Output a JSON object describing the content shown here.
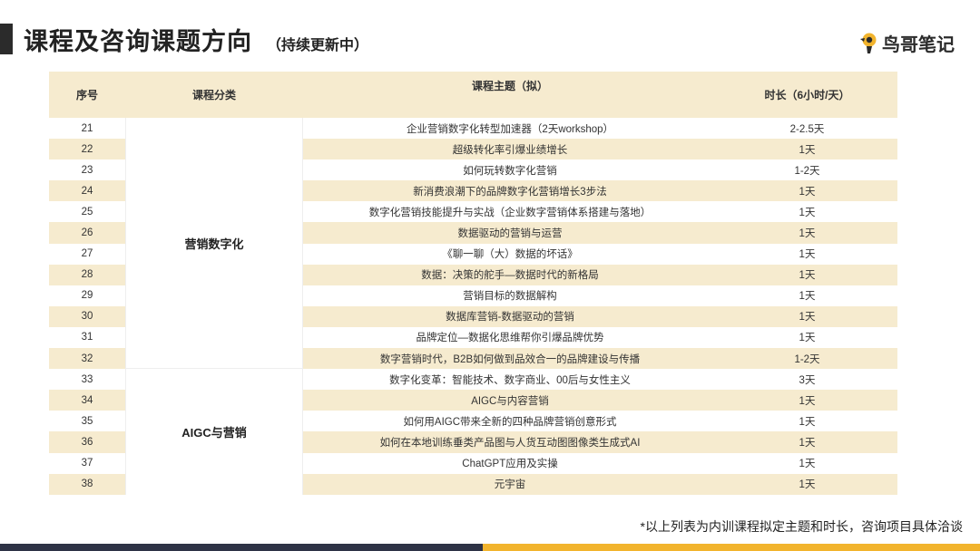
{
  "header": {
    "title": "课程及咨询课题方向",
    "subtitle": "（持续更新中）",
    "logo_text": "鸟哥笔记"
  },
  "table": {
    "columns": [
      "序号",
      "课程分类",
      "课程主题（拟）",
      "时长（6小时/天）"
    ],
    "groups": [
      {
        "name": "营销数字化",
        "rows": 12
      },
      {
        "name": "AIGC与营销",
        "rows": 6
      }
    ],
    "rows": [
      {
        "no": "21",
        "topic": "企业营销数字化转型加速器（2天workshop）",
        "duration": "2-2.5天"
      },
      {
        "no": "22",
        "topic": "超级转化率引爆业绩增长",
        "duration": "1天"
      },
      {
        "no": "23",
        "topic": "如何玩转数字化营销",
        "duration": "1-2天"
      },
      {
        "no": "24",
        "topic": "新消费浪潮下的品牌数字化营销增长3步法",
        "duration": "1天"
      },
      {
        "no": "25",
        "topic": "数字化营销技能提升与实战（企业数字营销体系搭建与落地）",
        "duration": "1天"
      },
      {
        "no": "26",
        "topic": "数据驱动的营销与运营",
        "duration": "1天"
      },
      {
        "no": "27",
        "topic": "《聊一聊（大）数据的坏话》",
        "duration": "1天"
      },
      {
        "no": "28",
        "topic": "数据：决策的舵手—数据时代的新格局",
        "duration": "1天"
      },
      {
        "no": "29",
        "topic": "营销目标的数据解构",
        "duration": "1天"
      },
      {
        "no": "30",
        "topic": "数据库营销-数据驱动的营销",
        "duration": "1天"
      },
      {
        "no": "31",
        "topic": "品牌定位—数据化思维帮你引爆品牌优势",
        "duration": "1天"
      },
      {
        "no": "32",
        "topic": "数字营销时代，B2B如何做到品效合一的品牌建设与传播",
        "duration": "1-2天"
      },
      {
        "no": "33",
        "topic": "数字化变革：智能技术、数字商业、00后与女性主义",
        "duration": "3天"
      },
      {
        "no": "34",
        "topic": "AIGC与内容营销",
        "duration": "1天"
      },
      {
        "no": "35",
        "topic": "如何用AIGC带来全新的四种品牌营销创意形式",
        "duration": "1天"
      },
      {
        "no": "36",
        "topic": "如何在本地训练垂类产品图与人货互动图图像类生成式AI",
        "duration": "1天"
      },
      {
        "no": "37",
        "topic": "ChatGPT应用及实操",
        "duration": "1天"
      },
      {
        "no": "38",
        "topic": "元宇宙",
        "duration": "1天"
      }
    ]
  },
  "footnote": "*以上列表为内训课程拟定主题和时长，咨询项目具体洽谈",
  "colors": {
    "header_fill": "#f6ebcf",
    "bottom_dark": "#2e3346",
    "bottom_gold": "#f2b42d"
  }
}
